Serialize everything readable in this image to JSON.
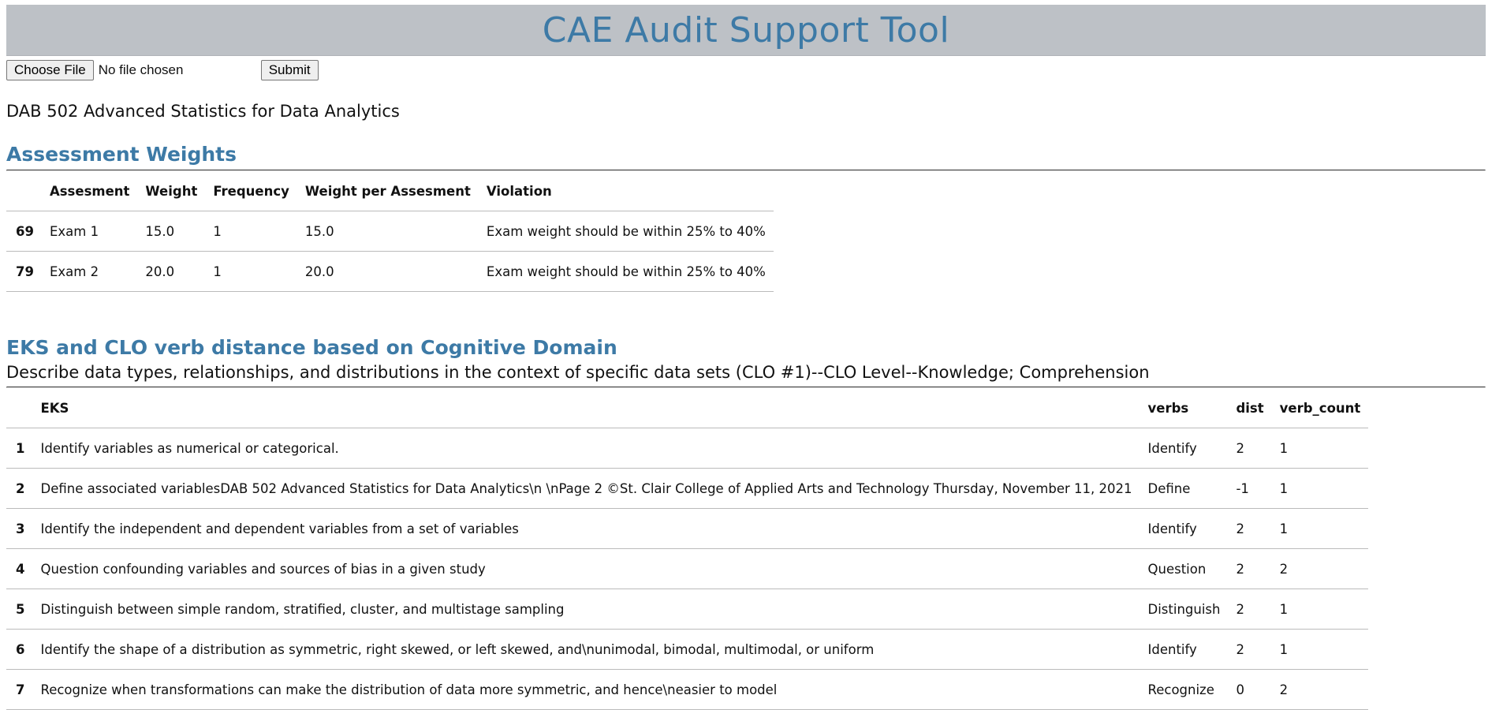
{
  "app": {
    "title": "CAE Audit Support Tool"
  },
  "upload": {
    "choose_label": "Choose File",
    "file_status": "No file chosen",
    "submit_label": "Submit"
  },
  "course": {
    "name": "DAB 502 Advanced Statistics for Data Analytics"
  },
  "assessment": {
    "heading": "Assessment Weights",
    "columns": [
      "",
      "Assesment",
      "Weight",
      "Frequency",
      "Weight per Assesment",
      "Violation"
    ],
    "rows": [
      [
        "69",
        "Exam 1",
        "15.0",
        "1",
        "15.0",
        "Exam weight should be within 25% to 40%"
      ],
      [
        "79",
        "Exam 2",
        "20.0",
        "1",
        "20.0",
        "Exam weight should be within 25% to 40%"
      ]
    ]
  },
  "eks": {
    "heading": "EKS and CLO verb distance based on Cognitive Domain",
    "clo_line": "Describe data types, relationships, and distributions in the context of specific data sets (CLO #1)--CLO Level--Knowledge; Comprehension",
    "columns": [
      "",
      "EKS",
      "verbs",
      "dist",
      "verb_count"
    ],
    "rows": [
      [
        "1",
        "Identify variables as numerical or categorical.",
        "Identify",
        "2",
        "1"
      ],
      [
        "2",
        "Define associated variablesDAB 502 Advanced Statistics for Data Analytics\\n \\nPage 2 ©St. Clair College of Applied Arts and Technology Thursday, November 11, 2021",
        "Define",
        "-1",
        "1"
      ],
      [
        "3",
        "Identify the independent and dependent variables from a set of variables",
        "Identify",
        "2",
        "1"
      ],
      [
        "4",
        "Question confounding variables and sources of bias in a given study",
        "Question",
        "2",
        "2"
      ],
      [
        "5",
        "Distinguish between simple random, stratified, cluster, and multistage sampling",
        "Distinguish",
        "2",
        "1"
      ],
      [
        "6",
        "Identify the shape of a distribution as symmetric, right skewed, or left skewed, and\\nunimodal, bimodal, multimodal, or uniform",
        "Identify",
        "2",
        "1"
      ],
      [
        "7",
        "Recognize when transformations can make the distribution of data more symmetric, and hence\\neasier to model",
        "Recognize",
        "0",
        "2"
      ]
    ]
  }
}
